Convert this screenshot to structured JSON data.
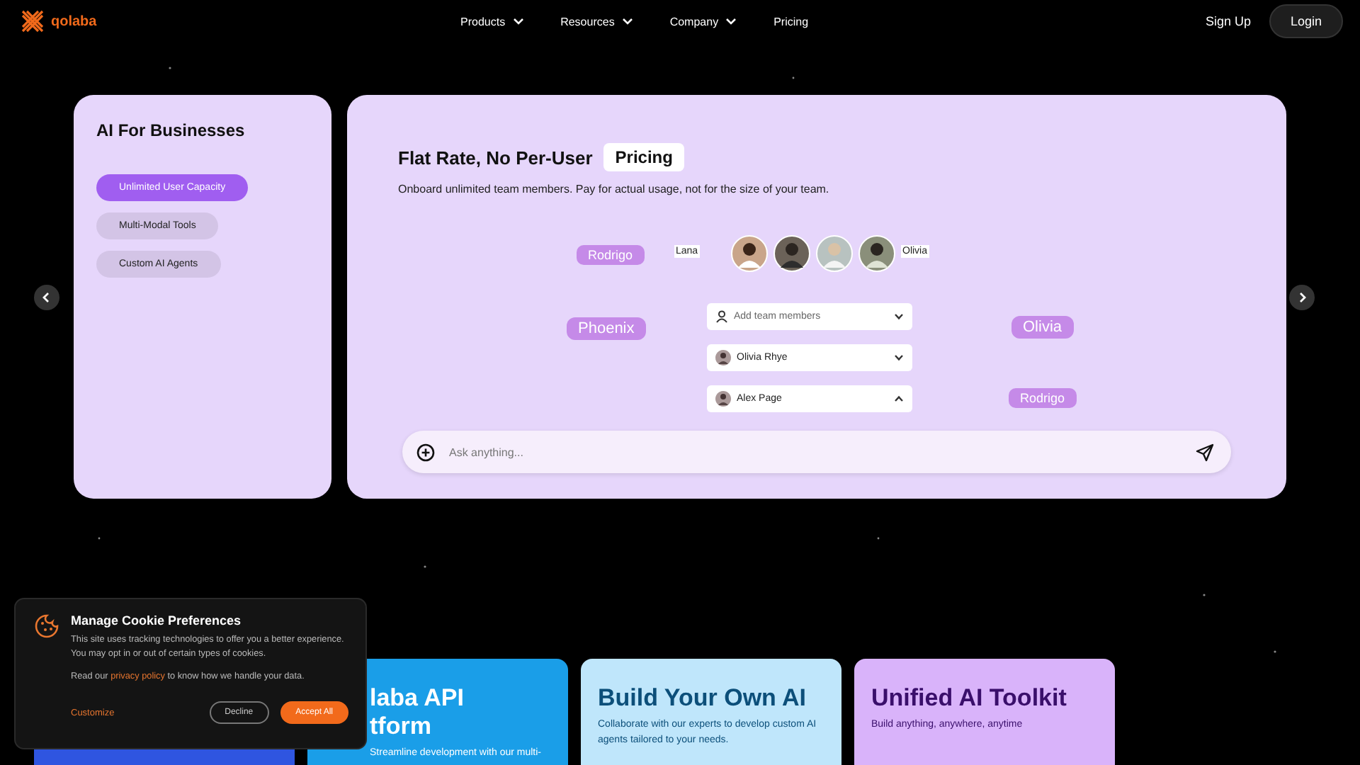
{
  "nav": {
    "logo": "qolaba",
    "links": [
      {
        "label": "Products",
        "dropdown": true
      },
      {
        "label": "Resources",
        "dropdown": true
      },
      {
        "label": "Company",
        "dropdown": true
      },
      {
        "label": "Pricing",
        "dropdown": false
      }
    ],
    "sign_up": "Sign Up",
    "login": "Login"
  },
  "hero": {
    "side_title": "AI For Businesses",
    "tabs": [
      {
        "label": "Unlimited User Capacity",
        "selected": true
      },
      {
        "label": "Multi-Modal Tools",
        "selected": false
      },
      {
        "label": "Custom AI Agents",
        "selected": false
      }
    ],
    "headline": "Flat Rate, No Per-User",
    "headline_badge": "Pricing",
    "subtitle": "Onboard unlimited team members. Pay for actual usage, not for the size of your team.",
    "tags": [
      {
        "label": "Rodrigo",
        "kind": "pill"
      },
      {
        "label": "Lana",
        "kind": "plain"
      },
      {
        "label": "Olivia",
        "kind": "plain"
      },
      {
        "label": "Phoenix",
        "kind": "big"
      },
      {
        "label": "Olivia",
        "kind": "big"
      },
      {
        "label": "Rodrigo",
        "kind": "pill"
      }
    ],
    "selects": [
      {
        "label": "Add team members",
        "kind": "placeholder",
        "expanded": false
      },
      {
        "label": "Olivia Rhye",
        "kind": "person",
        "expanded": false
      },
      {
        "label": "Alex Page",
        "kind": "person",
        "expanded": true
      }
    ],
    "ask": {
      "placeholder": "Ask anything..."
    }
  },
  "cards": [
    {
      "color": "#2f55e0"
    },
    {
      "color": "#1a9ee8",
      "title_lines": [
        "laba API",
        "tform"
      ],
      "text": "Streamline development with our multi-"
    },
    {
      "color": "#bfe6fb",
      "title_lines": [
        "Build Your Own AI"
      ],
      "text": "Collaborate with our experts to develop custom AI agents tailored to your needs."
    },
    {
      "color": "#d9b3fa",
      "title_lines": [
        "Unified AI Toolkit"
      ],
      "text": "Build anything, anywhere, anytime"
    }
  ],
  "cookie": {
    "title": "Manage Cookie Preferences",
    "text": "This site uses tracking technologies to offer you a better experience. You may opt in or out of certain types of cookies.",
    "policy_before": "Read our",
    "policy_link": "privacy policy",
    "policy_after": "to know how we handle your data.",
    "customize": "Customize",
    "decline": "Decline",
    "accept": "Accept All"
  }
}
